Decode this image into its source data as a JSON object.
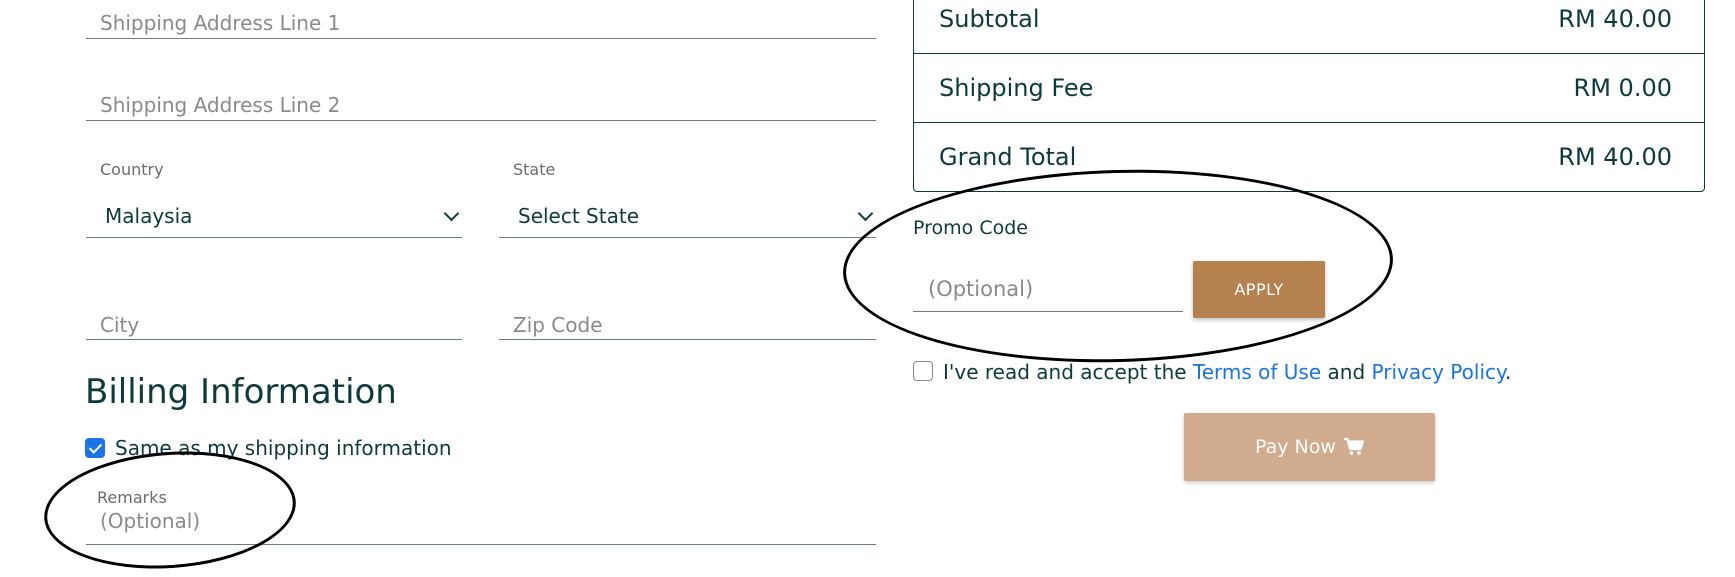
{
  "shipping": {
    "address1_placeholder": "Shipping Address Line 1",
    "address2_placeholder": "Shipping Address Line 2",
    "country_label": "Country",
    "country_value": "Malaysia",
    "state_label": "State",
    "state_value": "Select State",
    "city_placeholder": "City",
    "zip_placeholder": "Zip Code"
  },
  "billing": {
    "heading": "Billing Information",
    "same_as_shipping_label": "Same as my shipping information",
    "same_as_shipping_checked": true,
    "remarks_label": "Remarks",
    "remarks_placeholder": "(Optional)"
  },
  "summary": {
    "subtotal_label": "Subtotal",
    "subtotal_value": "RM 40.00",
    "shipping_label": "Shipping Fee",
    "shipping_value": "RM 0.00",
    "grand_total_label": "Grand Total",
    "grand_total_value": "RM 40.00"
  },
  "promo": {
    "label": "Promo Code",
    "placeholder": "(Optional)",
    "apply_label": "APPLY",
    "apply_color": "#b5824f"
  },
  "terms": {
    "prefix": "I've read and accept the",
    "terms_link": "Terms of Use",
    "and": "and",
    "privacy_link": "Privacy Policy",
    "suffix": ".",
    "checked": false
  },
  "pay": {
    "label": "Pay Now",
    "icon": "cart-icon",
    "color": "#d1ab8d"
  },
  "colors": {
    "primary_text": "#0d3b3b",
    "link": "#1a73e8"
  }
}
